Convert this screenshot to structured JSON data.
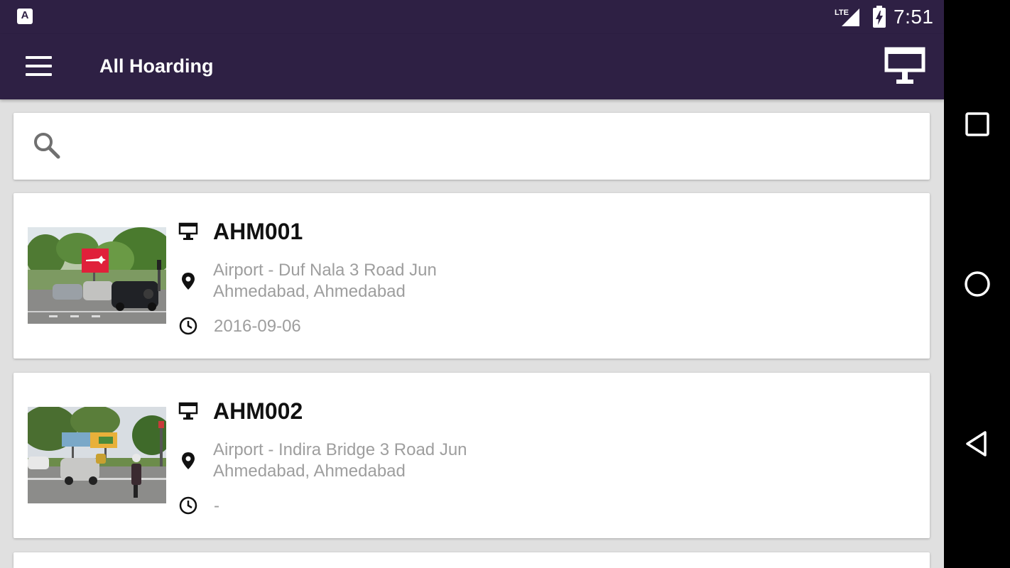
{
  "status_bar": {
    "notification_icon": "A",
    "network": "LTE",
    "time": "7:51"
  },
  "app_bar": {
    "title": "All Hoarding"
  },
  "search": {
    "placeholder": "",
    "value": ""
  },
  "hoardings": [
    {
      "code": "AHM001",
      "address_line1": "Airport  - Duf Nala 3 Road Jun",
      "address_line2": "Ahmedabad, Ahmedabad",
      "date": "2016-09-06"
    },
    {
      "code": "AHM002",
      "address_line1": "Airport  - Indira Bridge 3 Road Jun",
      "address_line2": "Ahmedabad, Ahmedabad",
      "date": "-"
    }
  ],
  "colors": {
    "primary": "#2e2044",
    "background": "#e0e0e0",
    "secondary_text": "#9e9e9e",
    "billboard_red": "#e0203a"
  },
  "icons": {
    "menu": "menu-icon",
    "hoarding": "billboard-icon",
    "search": "search-icon",
    "location": "location-pin-icon",
    "clock": "clock-icon",
    "nav_recents": "square-icon",
    "nav_home": "circle-icon",
    "nav_back": "triangle-back-icon"
  }
}
